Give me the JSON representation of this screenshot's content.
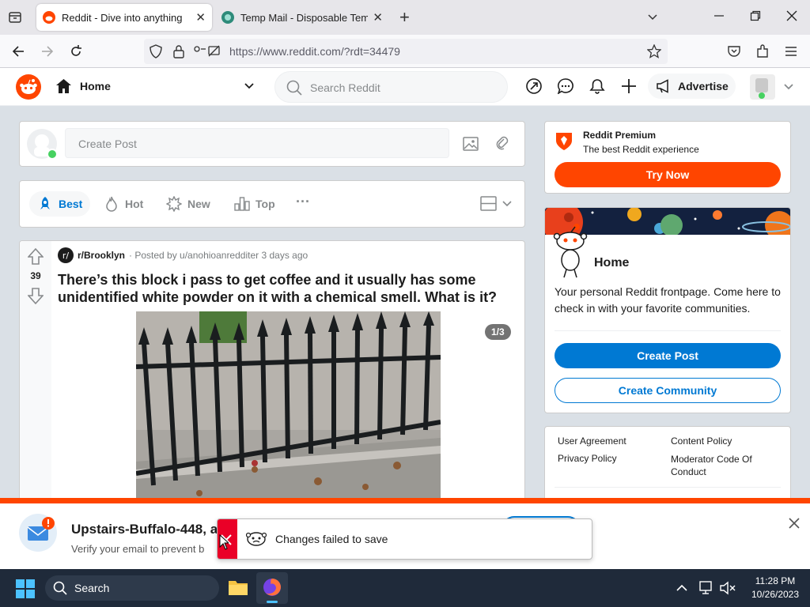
{
  "browser": {
    "tabs": [
      {
        "title": "Reddit - Dive into anything",
        "active": true
      },
      {
        "title": "Temp Mail - Disposable Tempor",
        "active": false
      }
    ],
    "url_host": "https://www.reddit.com",
    "url_path": "/?rdt=34479",
    "new_tab_symbol": "+"
  },
  "header": {
    "home_label": "Home",
    "search_placeholder": "Search Reddit",
    "advertise_label": "Advertise"
  },
  "create_post": {
    "placeholder": "Create Post"
  },
  "sort": {
    "items": [
      "Best",
      "Hot",
      "New",
      "Top"
    ],
    "active": "Best",
    "more": "···"
  },
  "post": {
    "votes": "39",
    "subreddit": "r/Brooklyn",
    "posted_by": "· Posted by u/anohioanredditer 3 days ago",
    "title": "There’s this block i pass to get coffee and it usually has some unidentified white powder on it with a chemical smell. What is it?",
    "gallery_counter": "1/3"
  },
  "premium": {
    "title": "Reddit Premium",
    "subtitle": "The best Reddit experience",
    "button": "Try Now"
  },
  "home_card": {
    "title": "Home",
    "description": "Your personal Reddit frontpage. Come here to check in with your favorite communities.",
    "create_post_button": "Create Post",
    "create_community_button": "Create Community"
  },
  "footer_links": [
    "User Agreement",
    "Content Policy",
    "Privacy Policy",
    "Moderator Code Of Conduct"
  ],
  "verify_banner": {
    "title": "Upstairs-Buffalo-448, ac",
    "subtitle": "Verify your email to prevent b"
  },
  "toast": {
    "message": "Changes failed to save"
  },
  "taskbar": {
    "search_label": "Search",
    "time": "11:28 PM",
    "date": "10/26/2023"
  },
  "colors": {
    "reddit_orange": "#ff4500",
    "reddit_blue": "#0079d3"
  }
}
